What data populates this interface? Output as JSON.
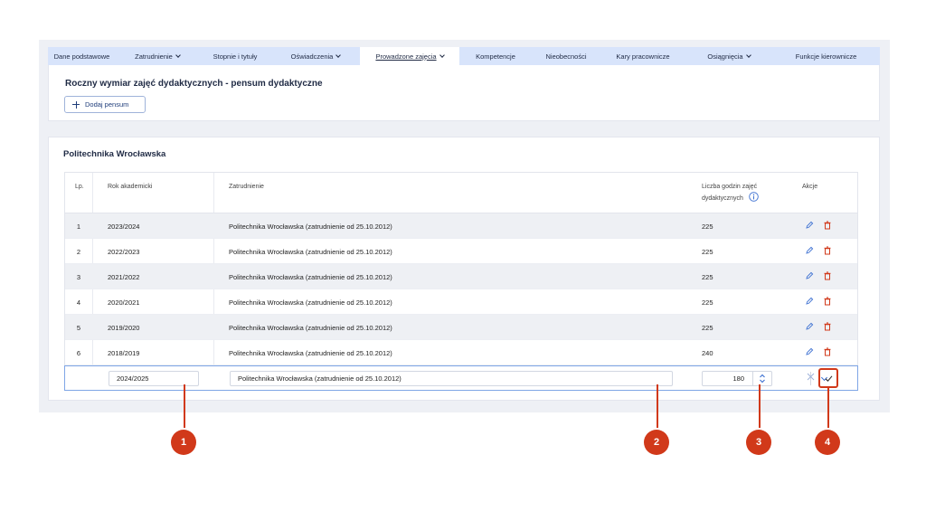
{
  "tabs": [
    {
      "label": "Dane podstawowe",
      "dropdown": false,
      "active": false
    },
    {
      "label": "Zatrudnienie",
      "dropdown": true,
      "active": false
    },
    {
      "label": "Stopnie i tytuły",
      "dropdown": false,
      "active": false
    },
    {
      "label": "Oświadczenia",
      "dropdown": true,
      "active": false
    },
    {
      "label": "Prowadzone zajęcia",
      "dropdown": true,
      "active": true
    },
    {
      "label": "Kompetencje",
      "dropdown": false,
      "active": false
    },
    {
      "label": "Nieobecności",
      "dropdown": false,
      "active": false
    },
    {
      "label": "Kary pracownicze",
      "dropdown": false,
      "active": false
    },
    {
      "label": "Osiągnięcia",
      "dropdown": true,
      "active": false
    },
    {
      "label": "Funkcje kierownicze",
      "dropdown": false,
      "active": false
    }
  ],
  "section": {
    "title": "Roczny wymiar zajęć dydaktycznych - pensum dydaktyczne",
    "add_label": "Dodaj pensum"
  },
  "university": {
    "name": "Politechnika Wrocławska"
  },
  "table": {
    "headers": {
      "lp": "Lp.",
      "rok": "Rok akademicki",
      "zat": "Zatrudnienie",
      "godz_line1": "Liczba godzin zajęć",
      "godz_line2": "dydaktycznych",
      "akcje": "Akcje"
    },
    "rows": [
      {
        "lp": "1",
        "rok": "2023/2024",
        "zat": "Politechnika Wrocławska (zatrudnienie od 25.10.2012)",
        "godz": "225"
      },
      {
        "lp": "2",
        "rok": "2022/2023",
        "zat": "Politechnika Wrocławska (zatrudnienie od 25.10.2012)",
        "godz": "225"
      },
      {
        "lp": "3",
        "rok": "2021/2022",
        "zat": "Politechnika Wrocławska (zatrudnienie od 25.10.2012)",
        "godz": "225"
      },
      {
        "lp": "4",
        "rok": "2020/2021",
        "zat": "Politechnika Wrocławska (zatrudnienie od 25.10.2012)",
        "godz": "225"
      },
      {
        "lp": "5",
        "rok": "2019/2020",
        "zat": "Politechnika Wrocławska (zatrudnienie od 25.10.2012)",
        "godz": "225"
      },
      {
        "lp": "6",
        "rok": "2018/2019",
        "zat": "Politechnika Wrocławska (zatrudnienie od 25.10.2012)",
        "godz": "240"
      }
    ],
    "edit_row": {
      "rok": "2024/2025",
      "zat": "Politechnika Wrocławska (zatrudnienie od 25.10.2012)",
      "godz": "180"
    }
  },
  "callouts": [
    "1",
    "2",
    "3",
    "4"
  ],
  "colors": {
    "accent": "#3b6fd1",
    "danger": "#d1391a",
    "tab_bg": "#d8e4fb"
  }
}
